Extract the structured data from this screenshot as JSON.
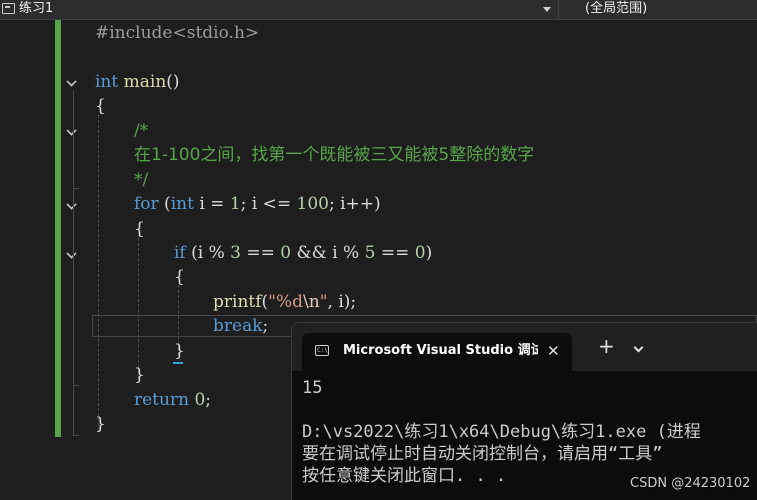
{
  "navbar": {
    "project_name": "练习1",
    "scope": "(全局范围)"
  },
  "editor": {
    "lines": {
      "include": "#include<stdio.h>",
      "main_kw": "int",
      "main_fn": "main",
      "main_paren": "()",
      "brace_open": "{",
      "comment_open": "/*",
      "comment_text": "在1-100之间，找第一个既能被三又能被5整除的数字",
      "comment_close": "*/",
      "for_kw": "for",
      "for_paren_open": " (",
      "for_int": "int",
      "for_rest_1": " i = ",
      "for_1": "1",
      "for_rest_2": "; i <= ",
      "for_100": "100",
      "for_rest_3": "; i++)",
      "for_brace_open": "{",
      "if_kw": "if",
      "if_rest_1": " (i % ",
      "if_3": "3",
      "if_rest_2": " == ",
      "if_0a": "0",
      "if_rest_3": " && i % ",
      "if_5": "5",
      "if_rest_4": " == ",
      "if_0b": "0",
      "if_rest_5": ")",
      "if_brace_open": "{",
      "printf_fn": "printf",
      "printf_paren": "(",
      "printf_str_open": "\"%d",
      "printf_esc": "\\n",
      "printf_str_close": "\"",
      "printf_rest": ", i);",
      "break_kw": "break",
      "break_semi": ";",
      "if_brace_close": "}",
      "for_brace_close": "}",
      "return_kw": "return",
      "return_sp": " ",
      "return_0": "0",
      "return_semi": ";",
      "brace_close": "}"
    }
  },
  "terminal": {
    "tab_icon": "C:\\",
    "tab_title": "Microsoft Visual Studio 调试控制台",
    "close_symbol": "✕",
    "new_tab_symbol": "+",
    "output_lines": [
      "15",
      "",
      "D:\\vs2022\\练习1\\x64\\Debug\\练习1.exe (进程",
      "要在调试停止时自动关闭控制台，请启用“工具”",
      "按任意键关闭此窗口. . ."
    ]
  },
  "watermark": "CSDN @24230102",
  "colors": {
    "keyword": "#569cd6",
    "function": "#dcdcaa",
    "comment": "#57a64a",
    "number": "#b5cea8",
    "string": "#d69d85",
    "change_bar": "#57a64a"
  }
}
